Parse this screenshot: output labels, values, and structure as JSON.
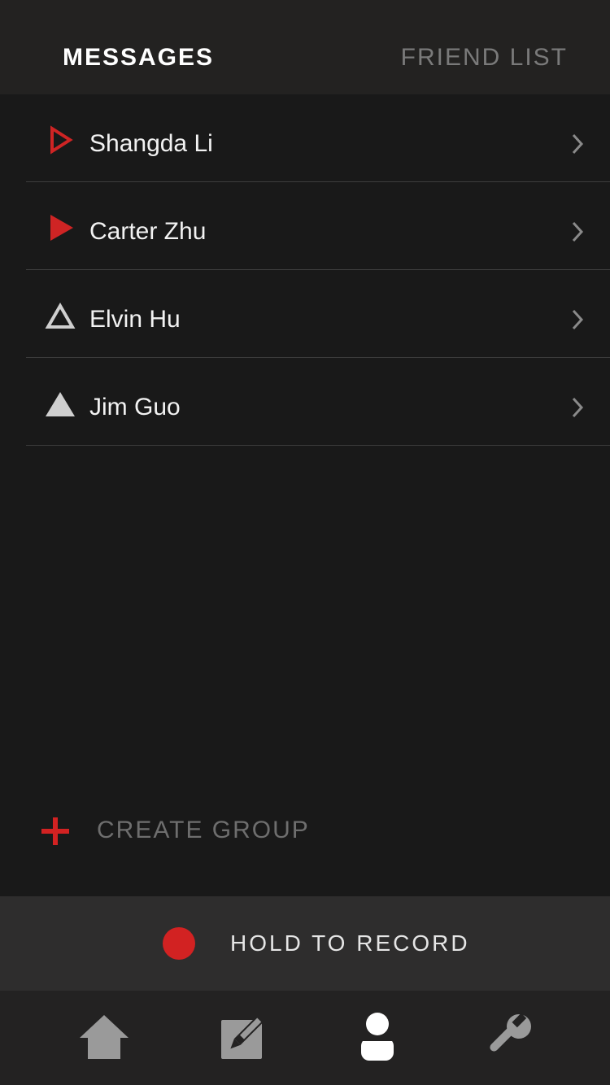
{
  "tabs": {
    "messages_label": "MESSAGES",
    "friends_label": "FRIEND LIST",
    "active": "MESSAGES"
  },
  "conversations": [
    {
      "name": "Shangda Li",
      "status_icon": "play-outline-icon",
      "status_color": "#cf2424"
    },
    {
      "name": "Carter Zhu",
      "status_icon": "play-filled-icon",
      "status_color": "#cf2424"
    },
    {
      "name": "Elvin Hu",
      "status_icon": "triangle-outline-icon",
      "status_color": "#cfcfcf"
    },
    {
      "name": "Jim Guo",
      "status_icon": "triangle-filled-icon",
      "status_color": "#cfcfcf"
    }
  ],
  "create_group": {
    "label": "CREATE GROUP",
    "icon": "plus-icon",
    "icon_color": "#d22222"
  },
  "record": {
    "label": "HOLD TO RECORD",
    "dot_color": "#d22222"
  },
  "bottom_nav": [
    {
      "icon": "home-icon",
      "active": false
    },
    {
      "icon": "edit-icon",
      "active": false
    },
    {
      "icon": "profile-icon",
      "active": true
    },
    {
      "icon": "wrench-icon",
      "active": false
    }
  ],
  "colors": {
    "accent": "#d22222",
    "background": "#191919",
    "header_bg": "#232221",
    "active_tab_text": "#ffffff",
    "inactive_tab_text": "#7a7a7a"
  }
}
